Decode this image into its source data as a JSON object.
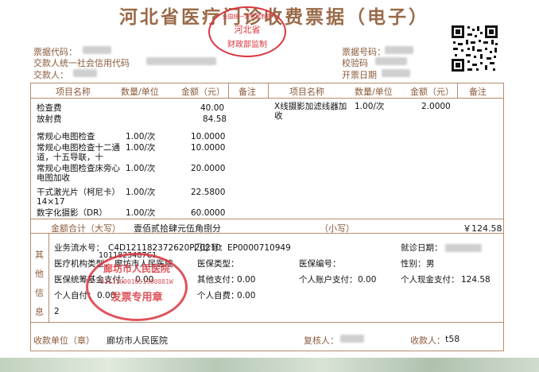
{
  "header": {
    "title": "河北省医疗门诊收费票据（电子）",
    "bill_code_label": "票据代码：",
    "payer_credit_label": "交款人统一社会信用代码",
    "payer_label": "交款人：",
    "bill_no_label": "票据号码：",
    "check_code_label": "校验码",
    "issue_date_label": "开票日期"
  },
  "top_seal": {
    "line1": "全国统一发票监制章",
    "line2": "河北省",
    "line3": "财政部监制"
  },
  "table_header": {
    "item": "项目名称",
    "qty_unit": "数量/单位",
    "amount": "金额（元）",
    "remark": "备注",
    "item2": "项目名称",
    "qty_unit2": "数量/单位",
    "amount2": "金额（元）",
    "remark2": "备注"
  },
  "items_left": [
    {
      "name": "检查费",
      "qty": "",
      "amount": "40.00"
    },
    {
      "name": "放射费",
      "qty": "",
      "amount": "84.58"
    },
    {
      "name": "常规心电图检查",
      "qty": "1.00/次",
      "amount": "10.0000"
    },
    {
      "name": "常规心电图检查十二通道，十五导联，十",
      "qty": "1.00/次",
      "amount": "10.0000"
    },
    {
      "name": "常规心电图检查床旁心电图加收",
      "qty": "1.00/次",
      "amount": "20.0000"
    },
    {
      "name": "干式激光片（柯尼卡）14×17",
      "qty": "1.00/次",
      "amount": "22.5800"
    },
    {
      "name": "数字化摄影（DR）",
      "qty": "1.00/次",
      "amount": "60.0000"
    }
  ],
  "items_right": [
    {
      "name": "X线摄影加滤线器加收",
      "qty": "1.00/次",
      "amount": "2.0000"
    }
  ],
  "total": {
    "label": "金额合计（大写）",
    "words": "壹佰贰拾肆元伍角捌分",
    "small_label": "（小写）",
    "value": "￥124.58"
  },
  "other_info": {
    "side_label": [
      "其",
      "他",
      "信",
      "息"
    ],
    "serial_label": "业务流水号：",
    "serial_value": "C4D121182372620P20210",
    "serial_value2": "1011823487C1",
    "clinic_no_label": "门诊号：",
    "clinic_no_value": "EP0000710949",
    "visit_date_label": "就诊日期：",
    "institution_label": "医疗机构类型：",
    "institution_value": "廊坊市人民医院",
    "insurance_type_label": "医保类型：",
    "insurance_no_label": "医保编号：",
    "gender_label": "性别：",
    "gender_value": "男",
    "fund_label": "医保统筹基金支付：",
    "fund_value": "0.00",
    "other_pay_label": "其他支付：",
    "other_pay_value": "0.00",
    "account_pay_label": "个人账户支付：",
    "account_pay_value": "0.00",
    "cash_pay_label": "个人现金支付：",
    "cash_pay_value": "124.58",
    "self_pay_label": "个人自付：",
    "self_pay_value": "0.00",
    "self_expense_label": "个人自费：",
    "self_expense_value": "0.00",
    "extra_value": "2"
  },
  "stamp": {
    "line1": "廊坊市人民医院",
    "line2": "发票专用章",
    "code": "911310001051900881W"
  },
  "footer": {
    "unit_label": "收款单位（章）",
    "unit_value": "廊坊市人民医院",
    "reviewer_label": "复核人：",
    "payee_label": "收款人：",
    "payee_value": "t58"
  }
}
